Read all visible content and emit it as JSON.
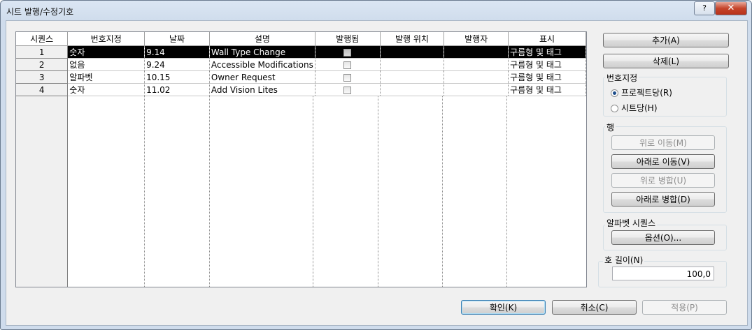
{
  "window": {
    "title": "시트 발행/수정기호",
    "help_label": "?",
    "close_label": "✕"
  },
  "table": {
    "headers": [
      "시퀀스",
      "번호지정",
      "날짜",
      "설명",
      "발행됨",
      "발행 위치",
      "발행자",
      "표시"
    ],
    "rows": [
      {
        "seq": "1",
        "numbering": "숫자",
        "date": "9.14",
        "description": "Wall Type Change",
        "issued": false,
        "issued_to": "",
        "issued_by": "",
        "show": "구름형 및 태그"
      },
      {
        "seq": "2",
        "numbering": "없음",
        "date": "9.24",
        "description": "Accessible Modifications",
        "issued": false,
        "issued_to": "",
        "issued_by": "",
        "show": "구름형 및 태그"
      },
      {
        "seq": "3",
        "numbering": "알파벳",
        "date": "10.15",
        "description": "Owner Request",
        "issued": false,
        "issued_to": "",
        "issued_by": "",
        "show": "구름형 및 태그"
      },
      {
        "seq": "4",
        "numbering": "숫자",
        "date": "11.02",
        "description": "Add Vision Lites",
        "issued": false,
        "issued_to": "",
        "issued_by": "",
        "show": "구름형 및 태그"
      }
    ],
    "selected_row": 0
  },
  "side": {
    "add_label": "추가(A)",
    "delete_label": "삭제(L)",
    "numbering_group": "번호지정",
    "per_project_label": "프로젝트당(R)",
    "per_sheet_label": "시트당(H)",
    "numbering_selected": "per_project",
    "row_group": "행",
    "move_up_label": "위로 이동(M)",
    "move_down_label": "아래로 이동(V)",
    "merge_up_label": "위로 병합(U)",
    "merge_down_label": "아래로 병합(D)",
    "alpha_group": "알파벳 시퀀스",
    "options_label": "옵션(O)...",
    "arc_group": "호 길이(N)",
    "arc_value": "100,0"
  },
  "footer": {
    "ok_label": "확인(K)",
    "cancel_label": "취소(C)",
    "apply_label": "적용(P)"
  }
}
